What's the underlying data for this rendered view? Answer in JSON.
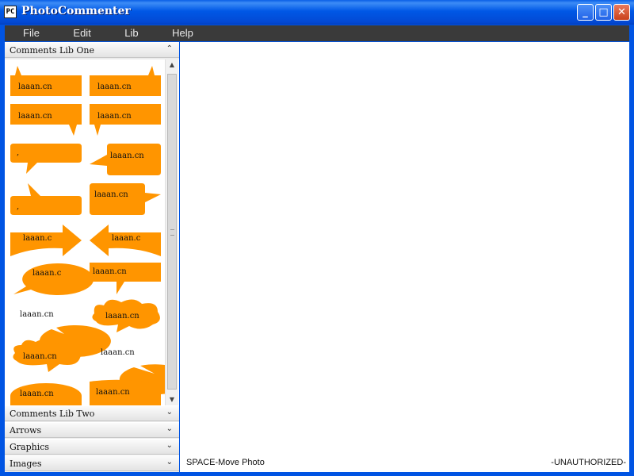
{
  "window": {
    "title": "PhotoCommenter",
    "app_icon": "PC"
  },
  "window_controls": {
    "minimize": "_",
    "maximize": "□",
    "close": "✕"
  },
  "menubar": {
    "items": [
      "File",
      "Edit",
      "Lib",
      "Help"
    ]
  },
  "sidebar": {
    "sections": [
      {
        "label": "Comments Lib One",
        "expanded": true,
        "chevron": "⌃"
      },
      {
        "label": "Comments Lib Two",
        "expanded": false,
        "chevron": "⌄"
      },
      {
        "label": "Arrows",
        "expanded": false,
        "chevron": "⌄"
      },
      {
        "label": "Graphics",
        "expanded": false,
        "chevron": "⌄"
      },
      {
        "label": "Images",
        "expanded": false,
        "chevron": "⌄"
      }
    ],
    "shape_color": "#ff9500",
    "shapes": [
      {
        "name": "balloon-tail-top-left",
        "text": "laaan.cn"
      },
      {
        "name": "balloon-tail-top-right",
        "text": "laaan.cn"
      },
      {
        "name": "balloon-tail-bottom-right",
        "text": "laaan.cn"
      },
      {
        "name": "balloon-tail-bottom-left",
        "text": "laaan.cn"
      },
      {
        "name": "rounded-balloon-tail-bottom",
        "text": ","
      },
      {
        "name": "rounded-balloon-tail-left",
        "text": "laaan.cn"
      },
      {
        "name": "rounded-balloon-tail-top",
        "text": ","
      },
      {
        "name": "rounded-balloon-tail-right",
        "text": "laaan.cn"
      },
      {
        "name": "arrow-right-banner",
        "text": "laaan.c"
      },
      {
        "name": "arrow-left-banner",
        "text": "laaan.c"
      },
      {
        "name": "oval-balloon-tail-left",
        "text": "laaan.c"
      },
      {
        "name": "rect-balloon-tail-bottom",
        "text": "laaan.cn"
      },
      {
        "name": "oval-balloon-tail-right",
        "text": "laaan.cn"
      },
      {
        "name": "cloud-balloon",
        "text": "laaan.cn"
      },
      {
        "name": "cloud-balloon-wide",
        "text": "laaan.cn"
      },
      {
        "name": "oval-balloon-tail-bottom-right",
        "text": "laaan.cn"
      },
      {
        "name": "oval-balloon-partial",
        "text": "laaan.cn"
      },
      {
        "name": "banner-partial",
        "text": "laaan.cn"
      }
    ],
    "scrollbar": {
      "up_arrow": "▲",
      "down_arrow": "▼"
    }
  },
  "status": {
    "left": "SPACE-Move Photo",
    "right": "-UNAUTHORIZED-"
  }
}
